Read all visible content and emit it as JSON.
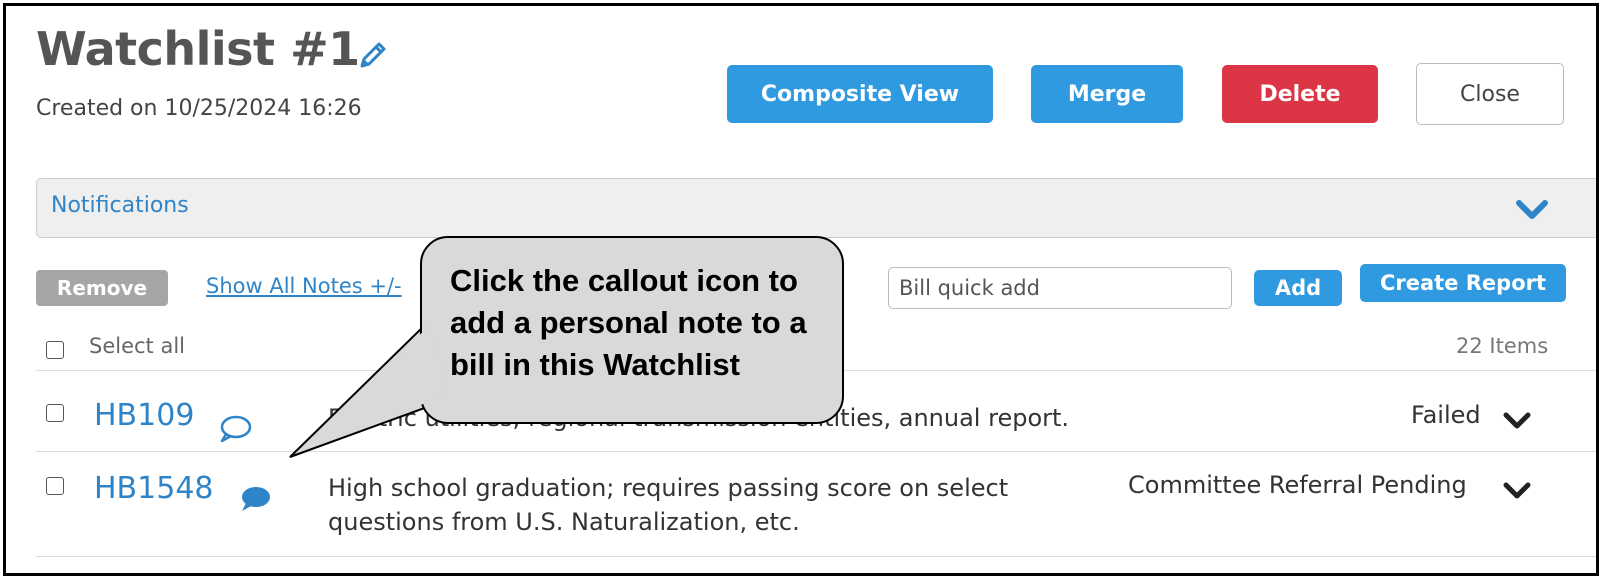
{
  "header": {
    "title": "Watchlist #1",
    "created": "Created on 10/25/2024 16:26"
  },
  "actions": {
    "composite_view": "Composite View",
    "merge": "Merge",
    "delete": "Delete",
    "close": "Close"
  },
  "notifications": {
    "label": "Notifications"
  },
  "toolbar": {
    "remove": "Remove",
    "show_all_notes": "Show All Notes +/-",
    "quick_add_placeholder": "Bill quick add",
    "add": "Add",
    "create_report": "Create Report"
  },
  "list": {
    "select_all": "Select all",
    "items_count": "22 Items",
    "bills": [
      {
        "id": "HB109",
        "description": "Electric utilities; regional transmission entities, annual report.",
        "status": "Failed",
        "note_icon": "comment-outline-icon"
      },
      {
        "id": "HB1548",
        "description": "High school graduation; requires passing score on select questions from U.S. Naturalization, etc.",
        "status": "Committee Referral Pending",
        "note_icon": "comment-filled-icon"
      }
    ]
  },
  "callout": {
    "text": "Click the callout icon to add a personal note to a bill in this Watchlist"
  },
  "colors": {
    "primary_blue": "#2f9ae0",
    "link_blue": "#2f84c8",
    "danger_red": "#dc3545"
  }
}
